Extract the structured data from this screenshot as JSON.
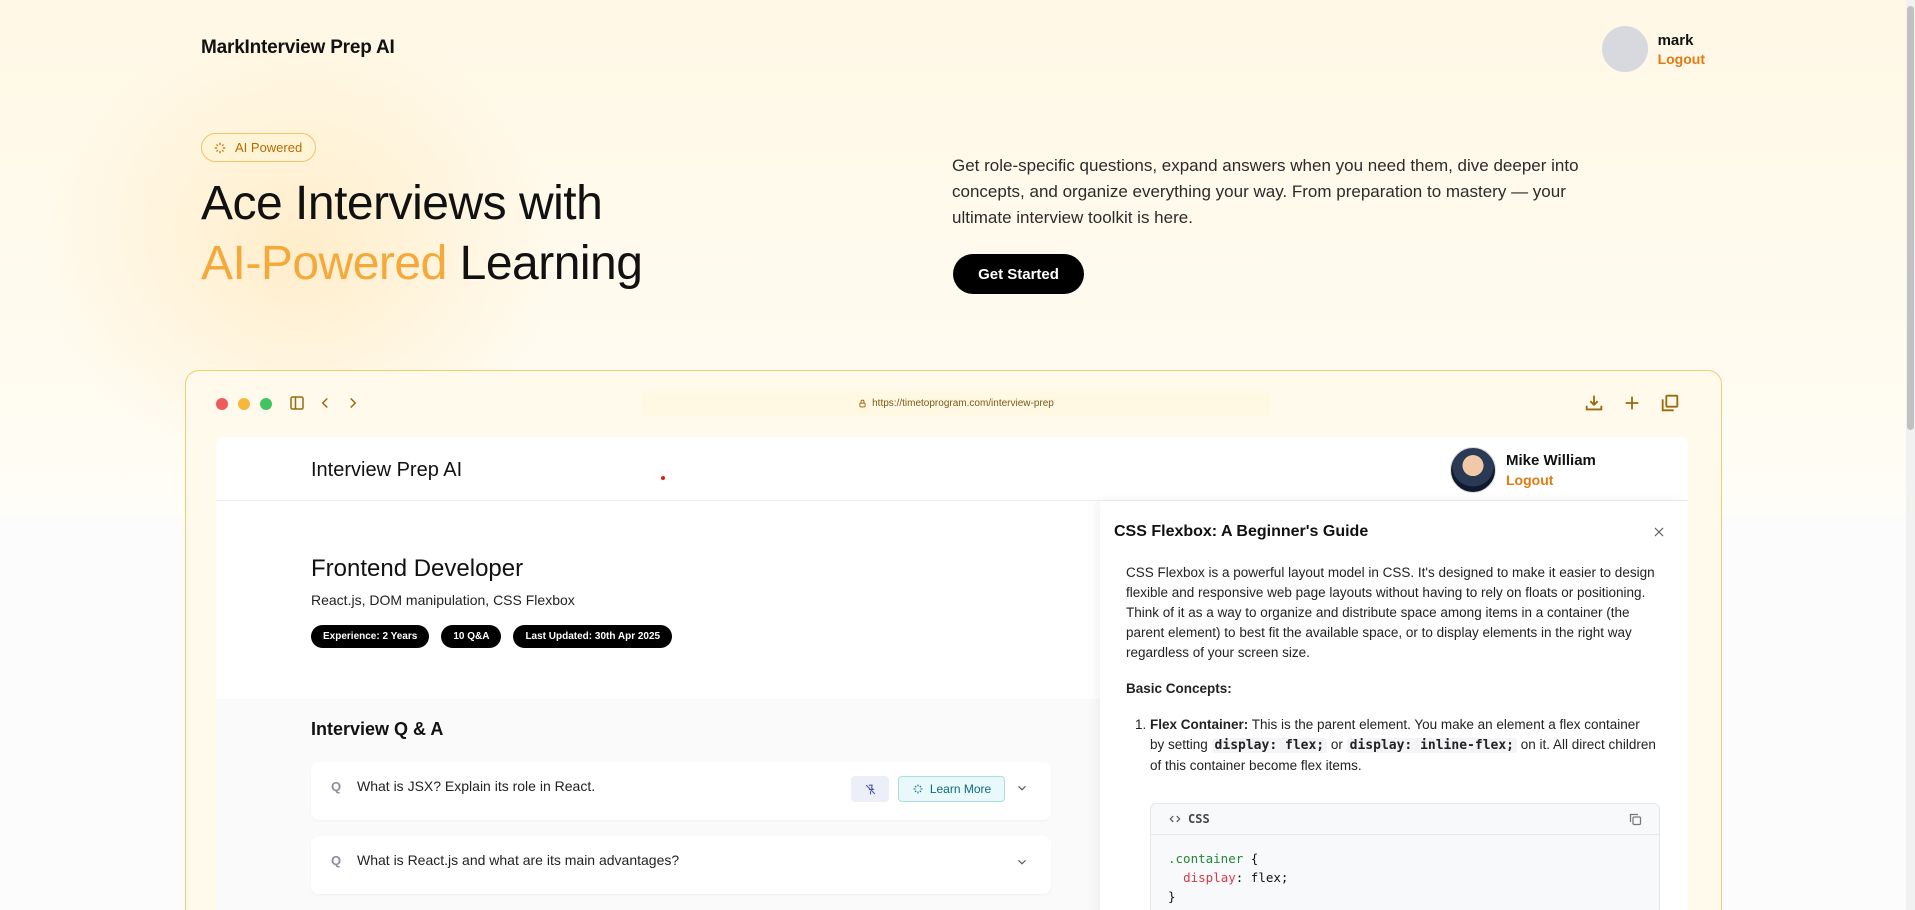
{
  "app": {
    "brand": "MarkInterview Prep AI",
    "user": {
      "name": "mark",
      "logout": "Logout"
    }
  },
  "hero": {
    "badge": "AI Powered",
    "title_line1": "Ace Interviews with",
    "title_accent": "AI-Powered",
    "title_rest": "Learning",
    "description": "Get role-specific questions, expand answers when you need them, dive deeper into concepts, and organize everything your way. From preparation to mastery — your ultimate interview toolkit is here.",
    "cta": "Get Started"
  },
  "colors": {
    "accent": "#f6a93b",
    "link": "#e07b12",
    "badge_border": "#f3c46a",
    "mock_border": "#f3cc6e"
  },
  "mockup": {
    "url": "https://timetoprogram.com/interview-prep",
    "inner": {
      "brand": "Interview Prep AI",
      "user": {
        "name": "Mike William",
        "logout": "Logout"
      },
      "role": {
        "title": "Frontend Developer",
        "topics": "React.js, DOM manipulation, CSS Flexbox",
        "pills": [
          "Experience: 2 Years",
          "10 Q&A",
          "Last Updated: 30th Apr 2025"
        ]
      },
      "qa": {
        "heading": "Interview Q & A",
        "q_marker": "Q",
        "learn_more": "Learn More",
        "items": [
          {
            "question": "What is JSX? Explain its role in React."
          },
          {
            "question": "What is React.js and what are its main advantages?"
          }
        ]
      },
      "drawer": {
        "title": "CSS Flexbox: A Beginner's Guide",
        "intro": "CSS Flexbox is a powerful layout model in CSS. It's designed to make it easier to design flexible and responsive web page layouts without having to rely on floats or positioning. Think of it as a way to organize and distribute space among items in a container (the parent element) to best fit the available space, or to display elements in the right way regardless of your screen size.",
        "basic_heading": "Basic Concepts:",
        "item1_bold": "Flex Container:",
        "item1_text_a": " This is the parent element. You make an element a flex container by setting ",
        "item1_code_a": "display: flex;",
        "item1_text_b": " or ",
        "item1_code_b": "display: inline-flex;",
        "item1_text_c": " on it. All direct children of this container become flex items.",
        "code_lang": "CSS",
        "code_line1_sel": ".container",
        "code_line1_rest": " {",
        "code_line2_prop": "display",
        "code_line2_rest": ": flex;",
        "code_line3": "}"
      }
    }
  }
}
